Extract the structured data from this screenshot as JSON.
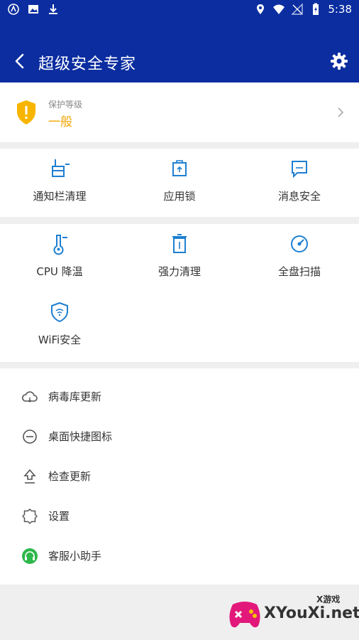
{
  "status_bar": {
    "time": "5:38",
    "left_icons": [
      "vpn-icon",
      "image-icon",
      "download-icon"
    ],
    "right_icons": [
      "location-icon",
      "wifi-icon",
      "no-sim-icon",
      "battery-charging-icon"
    ]
  },
  "app_bar": {
    "title": "超级安全专家",
    "back_icon": "back-arrow-icon",
    "settings_icon": "gear-icon"
  },
  "protection": {
    "label": "保护等级",
    "value": "一般",
    "value_color": "#F2A400"
  },
  "tools_row1": [
    {
      "label": "通知栏清理",
      "icon": "notification-clean-icon"
    },
    {
      "label": "应用锁",
      "icon": "app-lock-icon"
    },
    {
      "label": "消息安全",
      "icon": "message-security-icon"
    }
  ],
  "tools_row2": [
    {
      "label": "CPU 降温",
      "icon": "thermometer-icon"
    },
    {
      "label": "强力清理",
      "icon": "trash-icon"
    },
    {
      "label": "全盘扫描",
      "icon": "scan-gauge-icon"
    }
  ],
  "tools_row3": [
    {
      "label": "WiFi安全",
      "icon": "wifi-shield-icon"
    }
  ],
  "menu": [
    {
      "label": "病毒库更新",
      "icon": "cloud-icon"
    },
    {
      "label": "桌面快捷图标",
      "icon": "add-circle-icon"
    },
    {
      "label": "检查更新",
      "icon": "upload-icon"
    },
    {
      "label": "设置",
      "icon": "settings-outline-icon"
    },
    {
      "label": "客服小助手",
      "icon": "headset-icon"
    }
  ],
  "watermark": {
    "text": "XYouXi.net",
    "small": "X游戏"
  },
  "colors": {
    "primary": "#0B2DA0",
    "accent_icon": "#1E7FD1",
    "warning": "#F2A400",
    "support_green": "#2DB84B"
  }
}
